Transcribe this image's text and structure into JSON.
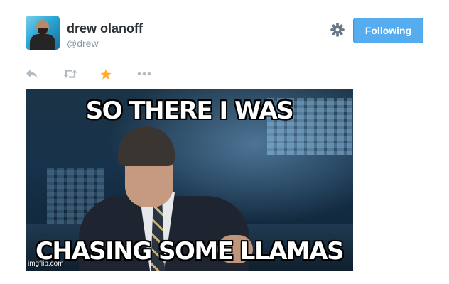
{
  "tweet": {
    "author": {
      "display_name": "drew olanoff",
      "handle": "@drew",
      "avatar_icon": "avatar-photo"
    },
    "follow_button": {
      "label": "Following",
      "color": "#55acee"
    },
    "settings_icon": "gear-icon",
    "actions": {
      "reply_icon": "reply-icon",
      "retweet_icon": "retweet-icon",
      "favorite_icon": "star-icon",
      "favorite_active_color": "#ffac33",
      "more_icon": "more-icon"
    },
    "media": {
      "top_text": "SO THERE I WAS",
      "bottom_text": "CHASING SOME LLAMAS",
      "watermark": "imgflip.com"
    }
  },
  "colors": {
    "name": "#292f33",
    "handle": "#8899a6",
    "icon_gray": "#b1bbc3"
  }
}
